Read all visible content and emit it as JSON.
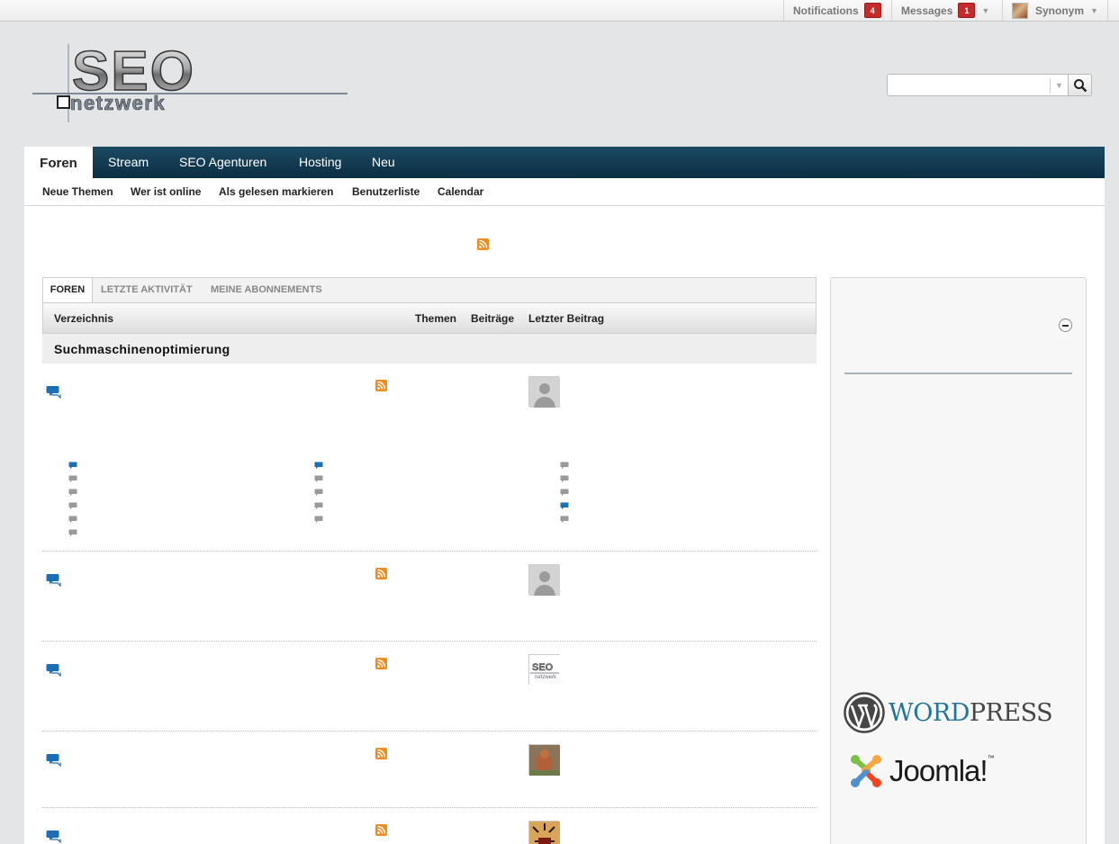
{
  "topbar": {
    "notifications_label": "Notifications",
    "notifications_count": "4",
    "messages_label": "Messages",
    "messages_count": "1",
    "user_name": "Synonym"
  },
  "logo": {
    "line1": "SEO",
    "line2": "netzwerk"
  },
  "search": {
    "placeholder": ""
  },
  "nav": {
    "tabs": [
      {
        "label": "Foren"
      },
      {
        "label": "Stream"
      },
      {
        "label": "SEO Agenturen"
      },
      {
        "label": "Hosting"
      },
      {
        "label": "Neu"
      }
    ],
    "sub": [
      {
        "label": "Neue Themen"
      },
      {
        "label": "Wer ist online"
      },
      {
        "label": "Als gelesen markieren"
      },
      {
        "label": "Benutzerliste"
      },
      {
        "label": "Calendar"
      }
    ]
  },
  "forum": {
    "tabs": [
      {
        "label": "FOREN"
      },
      {
        "label": "LETZTE AKTIVITÄT"
      },
      {
        "label": "MEINE ABONNEMENTS"
      }
    ],
    "columns": {
      "directory": "Verzeichnis",
      "topics": "Themen",
      "posts": "Beiträge",
      "last_post": "Letzter Beitrag"
    },
    "section_title": "Suchmaschinenoptimierung"
  },
  "sidebar": {
    "wordpress_word": "Word",
    "wordpress_press": "Press",
    "joomla": "Joomla!"
  },
  "colors": {
    "nav_bg": "#0c2e42",
    "badge": "#c62b2b",
    "rss": "#f18b1d",
    "forum_icon": "#1c6fb4",
    "wordpress_blue": "#21759b"
  }
}
